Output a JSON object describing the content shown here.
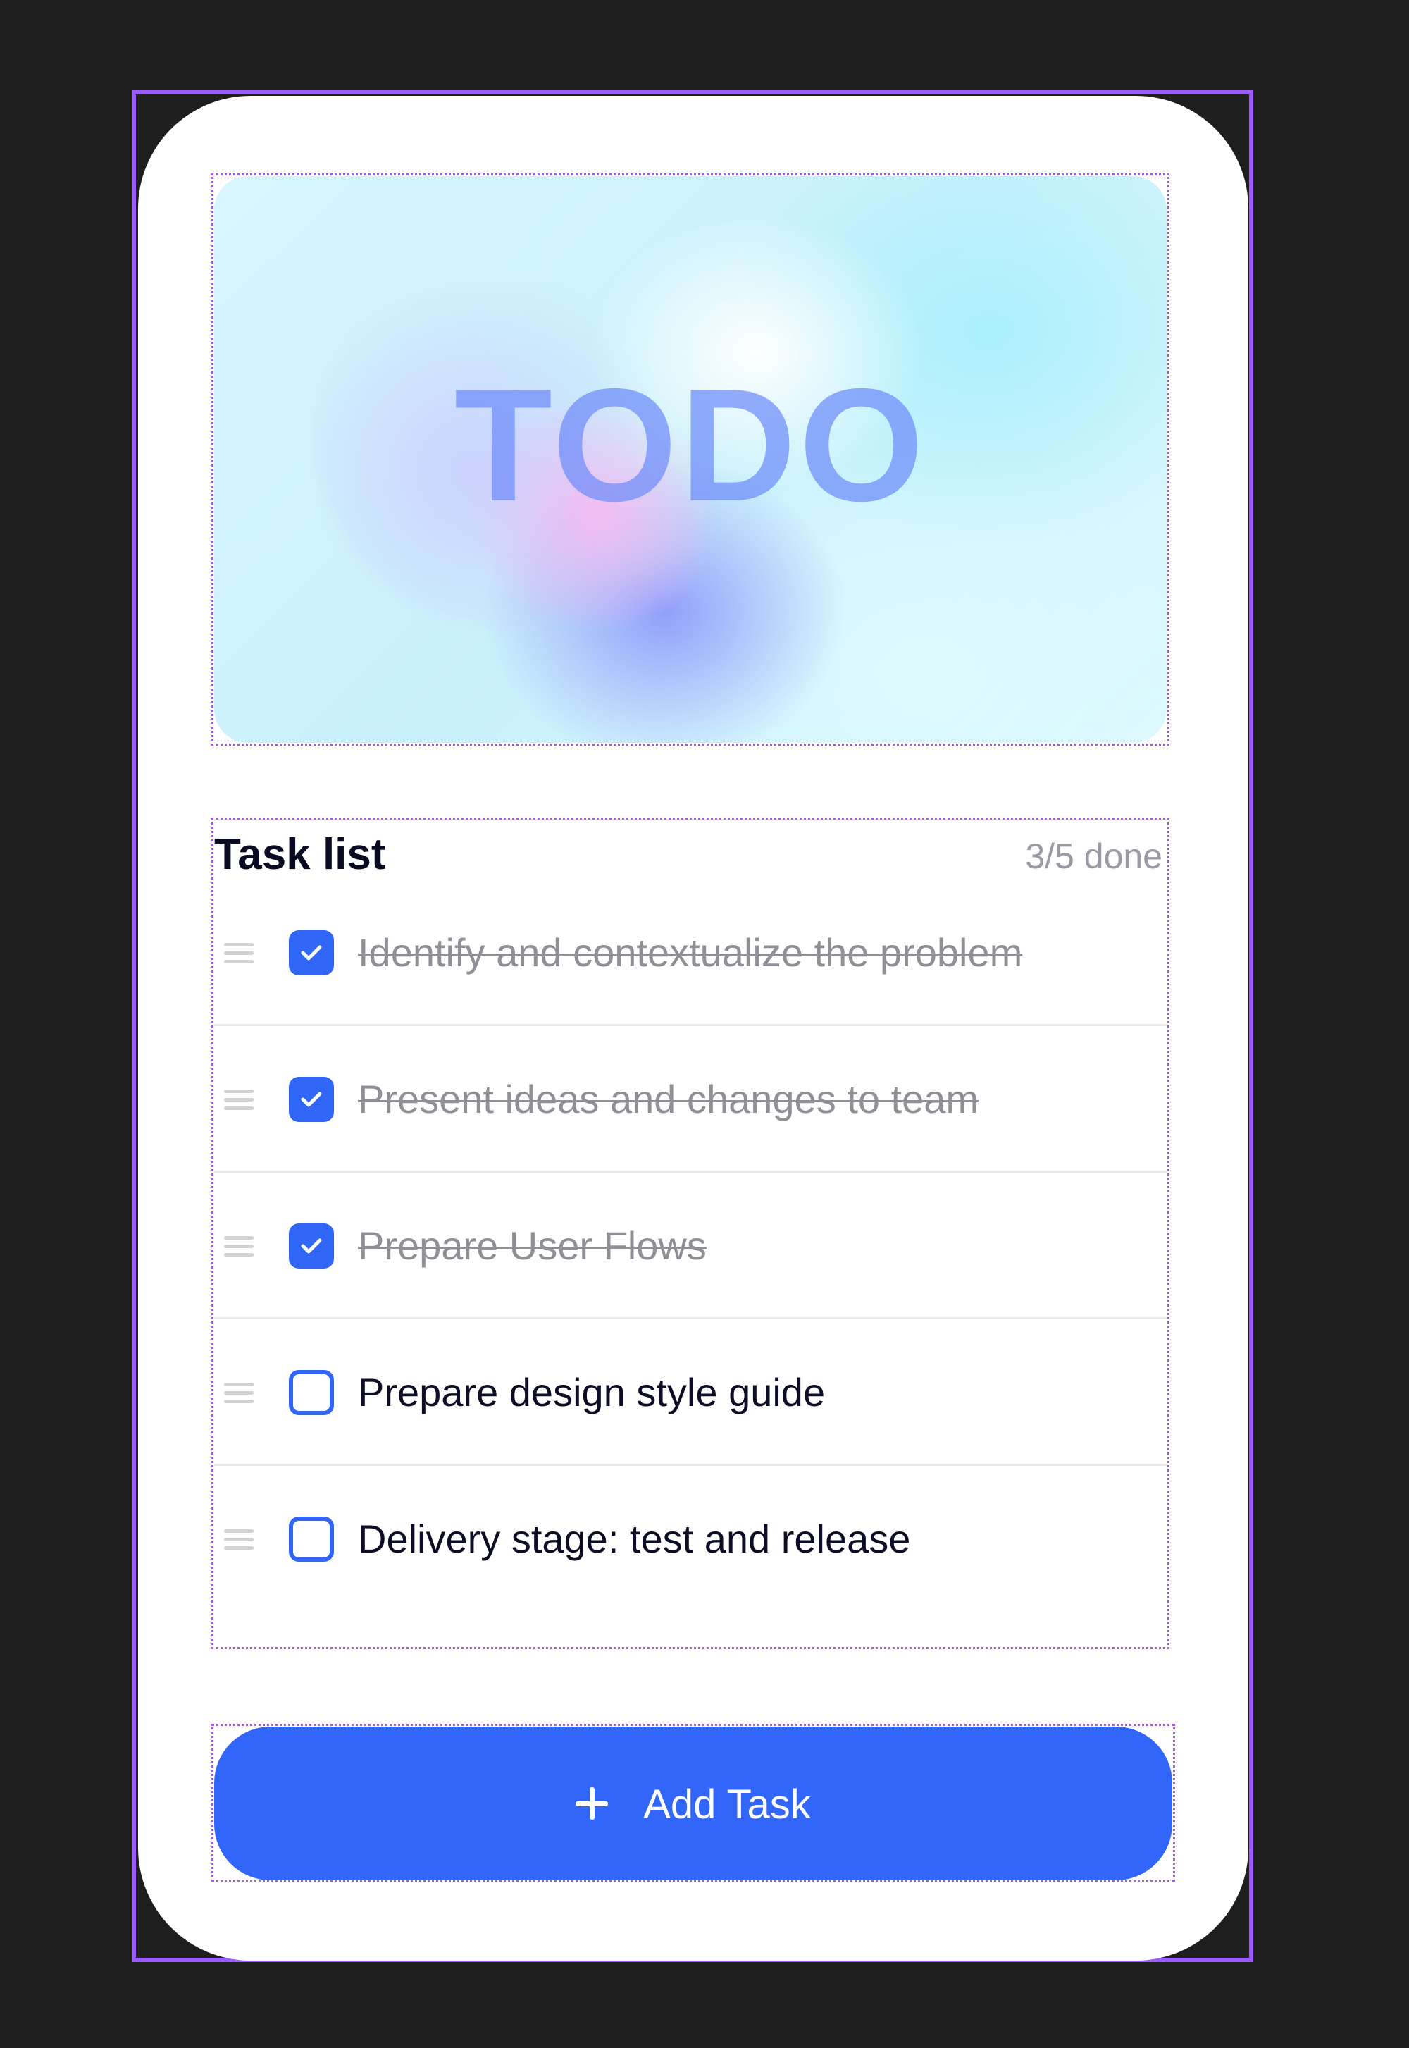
{
  "hero": {
    "title": "TODO"
  },
  "task_list": {
    "title": "Task list",
    "progress_text": "3/5 done",
    "done_count": 3,
    "total_count": 5,
    "items": [
      {
        "label": "Identify and contextualize the problem",
        "checked": true
      },
      {
        "label": "Present ideas and changes to team",
        "checked": true
      },
      {
        "label": "Prepare User Flows",
        "checked": true
      },
      {
        "label": "Prepare design style guide",
        "checked": false
      },
      {
        "label": "Delivery stage: test and release",
        "checked": false
      }
    ]
  },
  "add_button": {
    "label": "Add Task",
    "icon": "plus-icon"
  },
  "colors": {
    "accent": "#3266fb",
    "background": "#1e1e1e",
    "card": "#ffffff",
    "selection_outline": "#9b5cff",
    "done_text": "#8f8f96"
  }
}
